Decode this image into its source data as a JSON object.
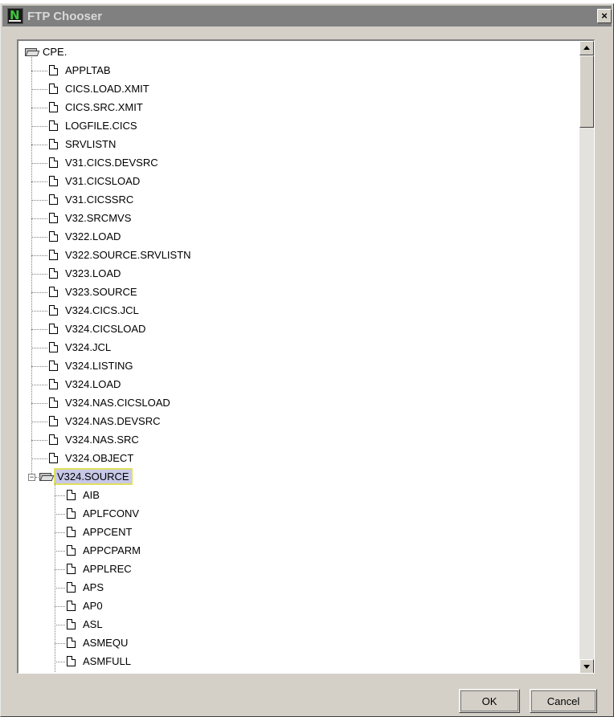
{
  "window": {
    "title": "FTP Chooser",
    "close_glyph": "×"
  },
  "tree": {
    "root": {
      "label": "CPE.",
      "icon": "folder-open-icon"
    },
    "items": [
      {
        "label": "APPLTAB"
      },
      {
        "label": "CICS.LOAD.XMIT"
      },
      {
        "label": "CICS.SRC.XMIT"
      },
      {
        "label": "LOGFILE.CICS"
      },
      {
        "label": "SRVLISTN"
      },
      {
        "label": "V31.CICS.DEVSRC"
      },
      {
        "label": "V31.CICSLOAD"
      },
      {
        "label": "V31.CICSSRC"
      },
      {
        "label": "V32.SRCMVS"
      },
      {
        "label": "V322.LOAD"
      },
      {
        "label": "V322.SOURCE.SRVLISTN"
      },
      {
        "label": "V323.LOAD"
      },
      {
        "label": "V323.SOURCE"
      },
      {
        "label": "V324.CICS.JCL"
      },
      {
        "label": "V324.CICSLOAD"
      },
      {
        "label": "V324.JCL"
      },
      {
        "label": "V324.LISTING"
      },
      {
        "label": "V324.LOAD"
      },
      {
        "label": "V324.NAS.CICSLOAD"
      },
      {
        "label": "V324.NAS.DEVSRC"
      },
      {
        "label": "V324.NAS.SRC"
      },
      {
        "label": "V324.OBJECT"
      }
    ],
    "expanded": {
      "label": "V324.SOURCE",
      "expander_glyph": "−",
      "children": [
        {
          "label": "AIB"
        },
        {
          "label": "APLFCONV"
        },
        {
          "label": "APPCENT"
        },
        {
          "label": "APPCPARM"
        },
        {
          "label": "APPLREC"
        },
        {
          "label": "APS"
        },
        {
          "label": "AP0"
        },
        {
          "label": "ASL"
        },
        {
          "label": "ASMEQU"
        },
        {
          "label": "ASMFULL"
        }
      ]
    }
  },
  "buttons": {
    "ok": "OK",
    "cancel": "Cancel"
  },
  "colors": {
    "titlebar": "#808080",
    "dialog": "#d4d0c8",
    "selection": "#c8c8e8"
  }
}
